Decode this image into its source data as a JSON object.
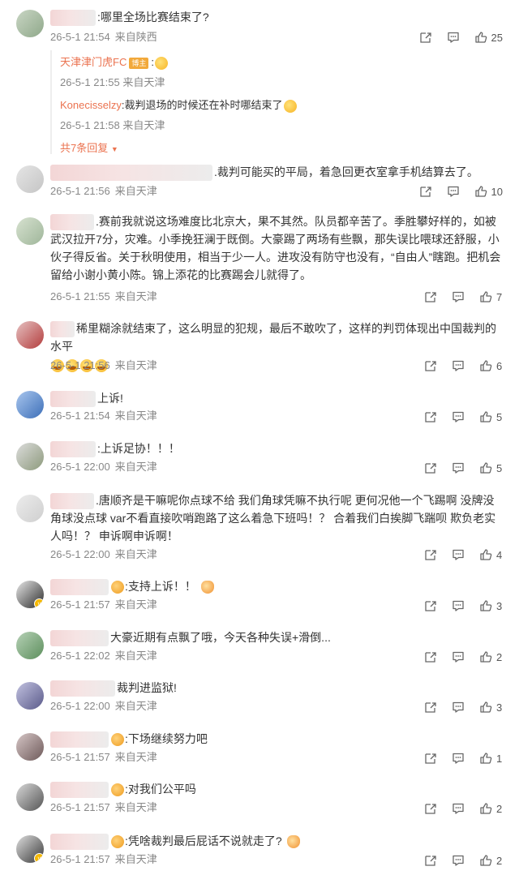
{
  "icons": {
    "share": "share-icon",
    "comment": "comment-icon",
    "like": "like-icon"
  },
  "colors": {
    "accent": "#eb7350",
    "meta": "#888888",
    "text": "#333333"
  },
  "comments": [
    {
      "text": ":哪里全场比赛结束了?",
      "date": "26-5-1 21:54",
      "location": "来自陕西",
      "likes": "25",
      "replies": [
        {
          "name": "天津津门虎FC",
          "tag": "博主",
          "text": ":",
          "date": "26-5-1 21:55",
          "location": "来自天津"
        },
        {
          "name": "Konecisselzy",
          "text": ":裁判退场的时候还在补时哪结束了",
          "date": "26-5-1 21:58",
          "location": "来自天津"
        }
      ],
      "more_replies": "共7条回复"
    },
    {
      "text": ".裁判可能买的平局，着急回更衣室拿手机结算去了。",
      "date": "26-5-1 21:56",
      "location": "来自天津",
      "likes": "10"
    },
    {
      "text": ".赛前我就说这场难度比北京大，果不其然。队员都辛苦了。季胜攀好样的，如被武汉拉开7分，灾难。小季挽狂澜于既倒。大豪踢了两场有些飘，那失误比喂球还舒服，小伙子得反省。关于秋明使用，相当于少一人。进攻没有防守也没有，“自由人”瞎跑。把机会留给小谢小黄小陈。锦上添花的比赛踢会儿就得了。",
      "date": "26-5-1 21:55",
      "location": "来自天津",
      "likes": "7"
    },
    {
      "text": "稀里糊涂就结束了，这么明显的犯规，最后不敢吹了，这样的判罚体现出中国裁判的水平",
      "date": "26-5-1 21:56",
      "location": "来自天津",
      "likes": "6"
    },
    {
      "text": "上诉!",
      "date": "26-5-1 21:54",
      "location": "来自天津",
      "likes": "5"
    },
    {
      "text": ":上诉足协！！！",
      "date": "26-5-1 22:00",
      "location": "来自天津",
      "likes": "5"
    },
    {
      "text": ".唐顺齐是干嘛呢你点球不给 我们角球凭嘛不执行呢 更何况他一个飞踢啊 没牌没角球没点球 var不看直接吹哨跑路了这么着急下班吗！？ 合着我们白挨脚飞踹呗 欺负老实人吗！？ 申诉啊申诉啊！",
      "date": "26-5-1 22:00",
      "location": "来自天津",
      "likes": "4"
    },
    {
      "text": ":支持上诉！！",
      "date": "26-5-1 21:57",
      "location": "来自天津",
      "likes": "3"
    },
    {
      "text": "大豪近期有点飘了哦，今天各种失误+滑倒...",
      "date": "26-5-1 22:02",
      "location": "来自天津",
      "likes": "2"
    },
    {
      "text": "裁判进监狱!",
      "date": "26-5-1 22:00",
      "location": "来自天津",
      "likes": "3"
    },
    {
      "text": ":下场继续努力吧",
      "date": "26-5-1 21:57",
      "location": "来自天津",
      "likes": "1"
    },
    {
      "text": ":对我们公平吗",
      "date": "26-5-1 21:57",
      "location": "来自天津",
      "likes": "2"
    },
    {
      "text": ":凭啥裁判最后屁话不说就走了?",
      "date": "26-5-1 21:57",
      "location": "来自天津",
      "likes": "2"
    }
  ]
}
